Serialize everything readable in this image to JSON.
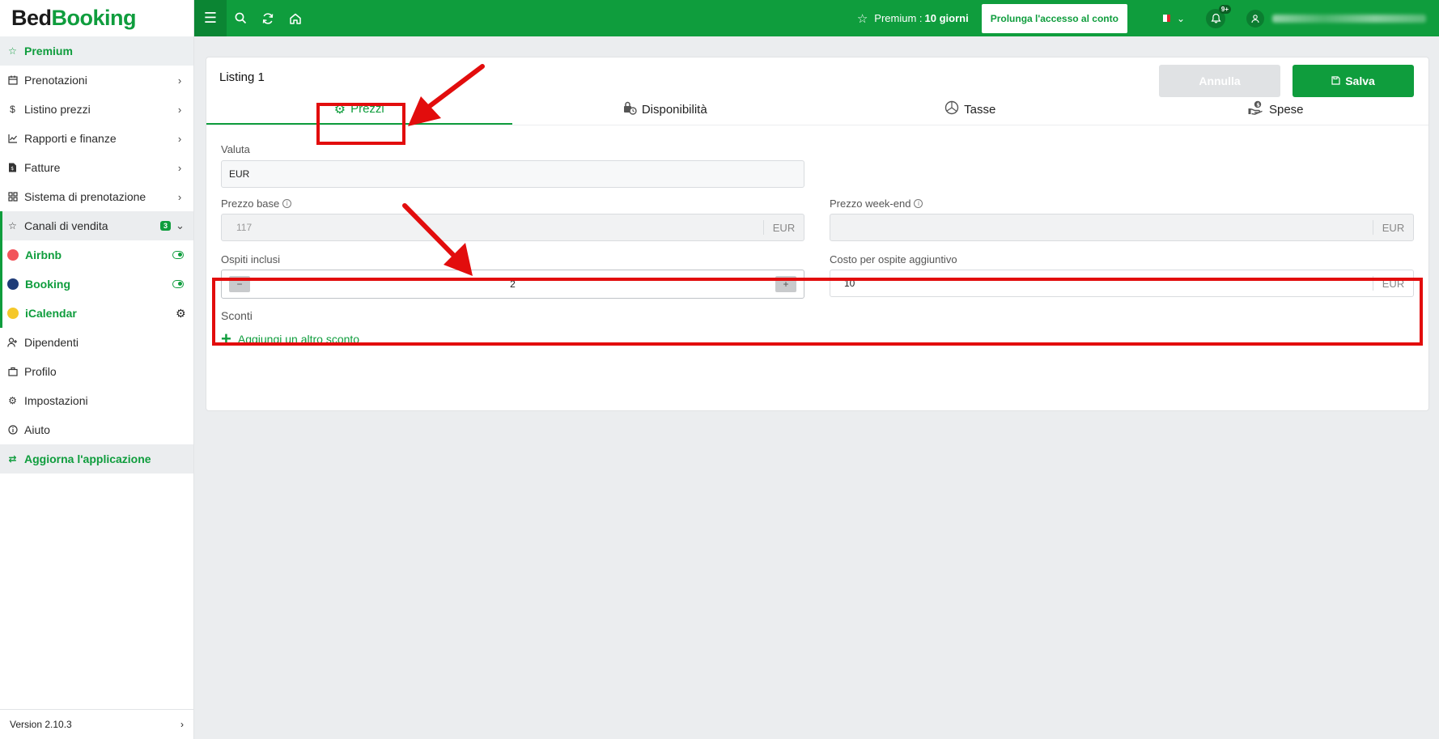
{
  "brand": {
    "part1": "Bed",
    "part2": "Booking"
  },
  "sidebar": {
    "premium": "Premium",
    "items": [
      {
        "label": "Prenotazioni",
        "icon": "calendar-icon"
      },
      {
        "label": "Listino prezzi",
        "icon": "dollar-icon"
      },
      {
        "label": "Rapporti e finanze",
        "icon": "chart-line-icon"
      },
      {
        "label": "Fatture",
        "icon": "invoice-icon"
      },
      {
        "label": "Sistema di prenotazione",
        "icon": "grid-icon"
      }
    ],
    "channels": {
      "label": "Canali di vendita",
      "badge": "3"
    },
    "sub": [
      {
        "label": "Airbnb",
        "color": "#f2545b"
      },
      {
        "label": "Booking",
        "color": "#1f3c78"
      },
      {
        "label": "iCalendar",
        "color": "#f5c82a"
      }
    ],
    "items2": [
      {
        "label": "Dipendenti",
        "icon": "user-plus-icon"
      },
      {
        "label": "Profilo",
        "icon": "briefcase-icon"
      },
      {
        "label": "Impostazioni",
        "icon": "gear-icon"
      },
      {
        "label": "Aiuto",
        "icon": "info-icon"
      }
    ],
    "update": "Aggiorna l'applicazione",
    "version": "Version 2.10.3"
  },
  "topbar": {
    "premium_prefix": "Premium :",
    "premium_days": "10 giorni",
    "extend": "Prolunga l'accesso al conto",
    "notifications": "9+"
  },
  "card": {
    "title": "Listing 1",
    "cancel": "Annulla",
    "save": "Salva",
    "tabs": [
      "Prezzi",
      "Disponibilità",
      "Tasse",
      "Spese"
    ],
    "currency_label": "Valuta",
    "currency_value": "EUR",
    "base_price_label": "Prezzo base",
    "base_price_placeholder": "117",
    "weekend_price_label": "Prezzo week-end",
    "unit": "EUR",
    "guests_label": "Ospiti inclusi",
    "guests_value": "2",
    "extra_cost_label": "Costo per ospite aggiuntivo",
    "extra_cost_value": "10",
    "discounts_label": "Sconti",
    "add_discount": "Aggiungi un altro sconto"
  },
  "colors": {
    "accent": "#0f9d3d",
    "annotation": "#e20d0d"
  }
}
